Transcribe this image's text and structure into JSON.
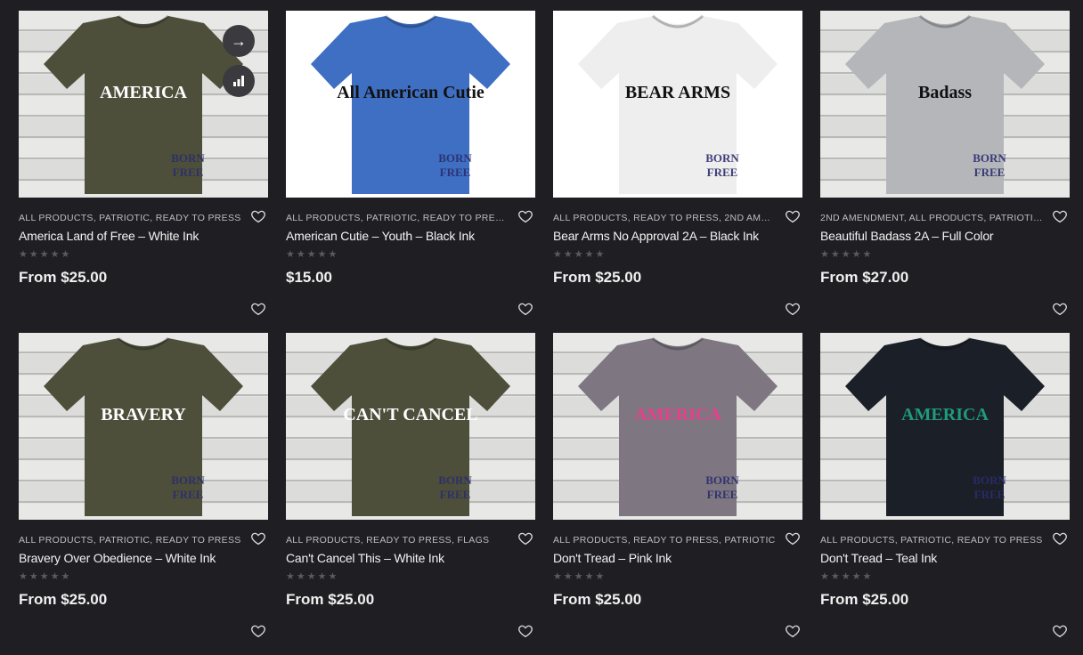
{
  "overlay": {
    "next_icon": "arrow-right-icon",
    "compare_icon": "bar-chart-icon"
  },
  "colors": {
    "background": "#1f1e23",
    "text": "#f2f2f2",
    "muted": "#bdbdbd"
  },
  "products": [
    {
      "categories": "ALL PRODUCTS, PATRIOTIC, READY TO PRESS",
      "title": "America Land of Free – White Ink",
      "price": "From $25.00",
      "shirt_color": "#4d4f3a",
      "bg": "wood",
      "art": "AMERICA",
      "art_color": "#ffffff"
    },
    {
      "categories": "ALL PRODUCTS, PATRIOTIC, READY TO PRESS,...",
      "title": "American Cutie – Youth – Black Ink",
      "price": "$15.00",
      "shirt_color": "#3f6fc2",
      "bg": "white",
      "art": "All American Cutie",
      "art_color": "#111111"
    },
    {
      "categories": "ALL PRODUCTS, READY TO PRESS, 2ND AMEN...",
      "title": "Bear Arms No Approval 2A – Black Ink",
      "price": "From $25.00",
      "shirt_color": "#eeeeee",
      "bg": "white",
      "art": "BEAR ARMS",
      "art_color": "#111111"
    },
    {
      "categories": "2ND AMENDMENT, ALL PRODUCTS, PATRIOTIC, ...",
      "title": "Beautiful Badass 2A – Full Color",
      "price": "From $27.00",
      "shirt_color": "#b4b6ba",
      "bg": "wood",
      "art": "Badass",
      "art_color": "#111111"
    },
    {
      "categories": "ALL PRODUCTS, PATRIOTIC, READY TO PRESS",
      "title": "Bravery Over Obedience – White Ink",
      "price": "From $25.00",
      "shirt_color": "#4d4f3a",
      "bg": "wood",
      "art": "BRAVERY",
      "art_color": "#ffffff"
    },
    {
      "categories": "ALL PRODUCTS, READY TO PRESS, FLAGS",
      "title": "Can't Cancel This – White Ink",
      "price": "From $25.00",
      "shirt_color": "#4d4f3a",
      "bg": "wood",
      "art": "CAN'T CANCEL",
      "art_color": "#ffffff"
    },
    {
      "categories": "ALL PRODUCTS, READY TO PRESS, PATRIOTIC",
      "title": "Don't Tread – Pink Ink",
      "price": "From $25.00",
      "shirt_color": "#7e7781",
      "bg": "wood",
      "art": "AMERICA",
      "art_color": "#e83e8c"
    },
    {
      "categories": "ALL PRODUCTS, PATRIOTIC, READY TO PRESS",
      "title": "Don't Tread – Teal Ink",
      "price": "From $25.00",
      "shirt_color": "#1b1f27",
      "bg": "wood",
      "art": "AMERICA",
      "art_color": "#1f9a7a"
    }
  ]
}
